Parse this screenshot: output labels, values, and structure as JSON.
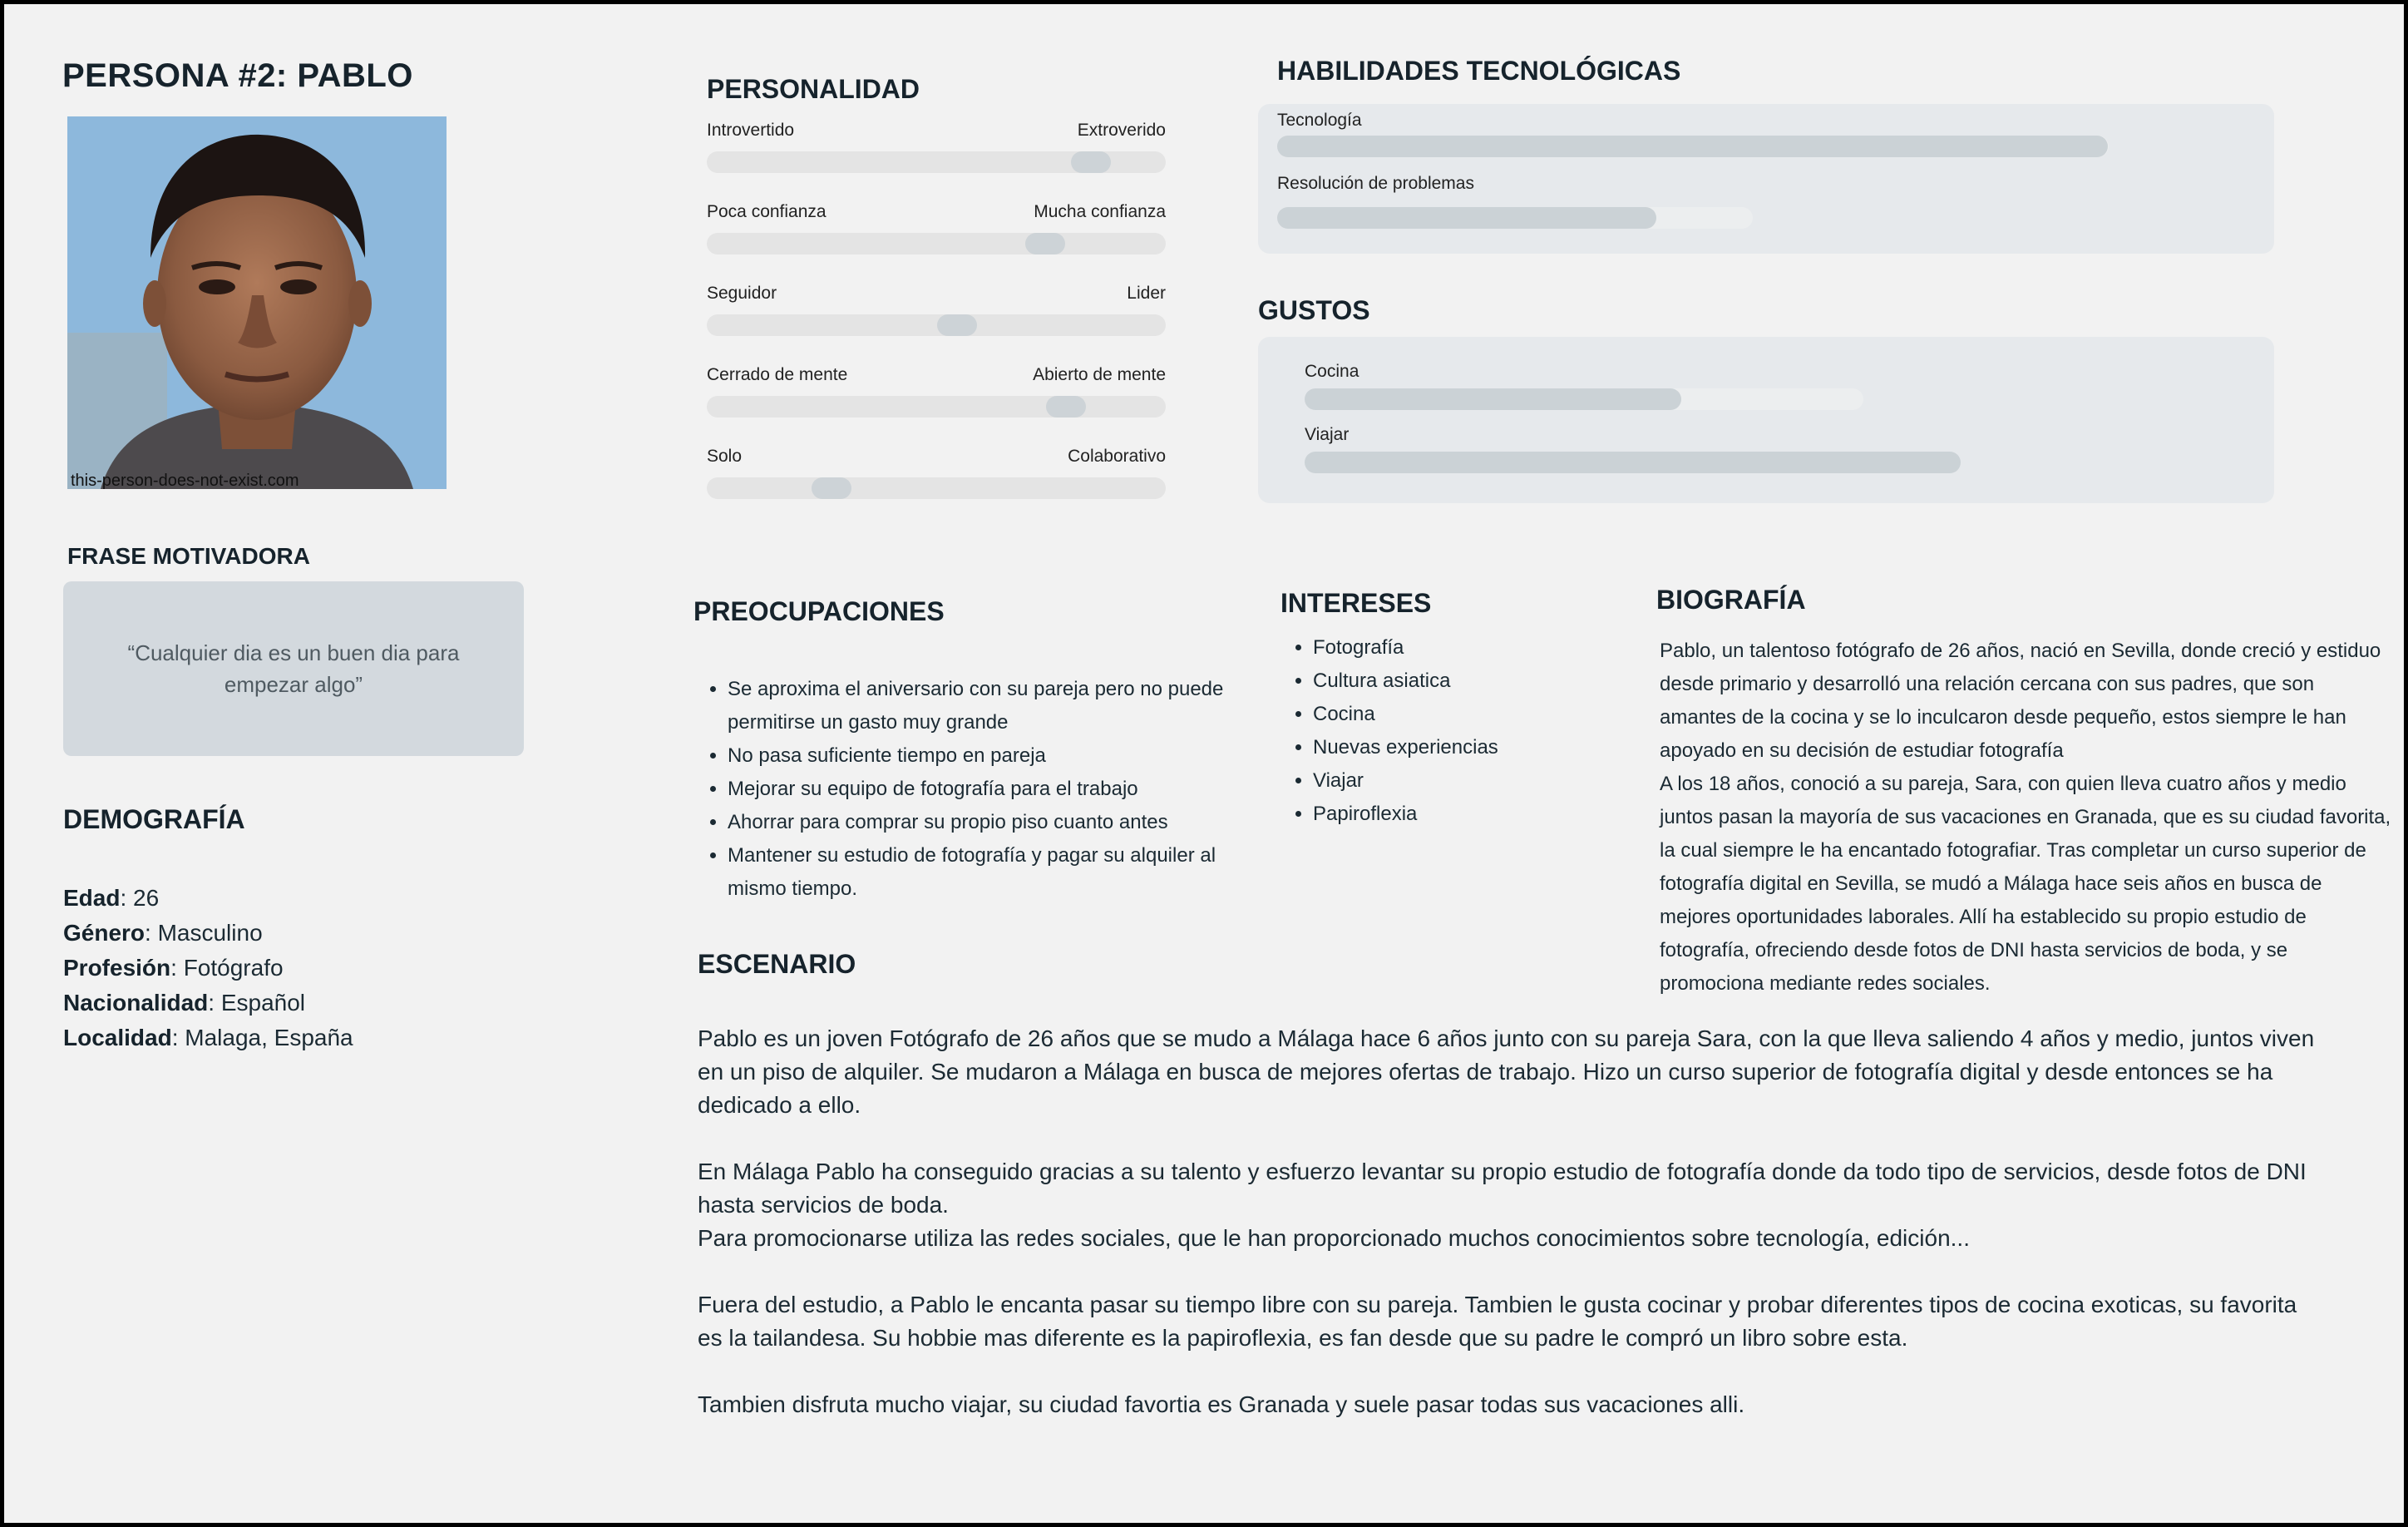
{
  "title": "PERSONA #2:  PABLO",
  "photo": {
    "credit": "this-person-does-not-exist.com"
  },
  "quote": {
    "heading": "FRASE MOTIVADORA",
    "text": "“Cualquier dia es un buen dia para empezar algo”"
  },
  "demography": {
    "heading": "DEMOGRAFÍA",
    "items": [
      {
        "key": "Edad",
        "value": ": 26"
      },
      {
        "key": "Género",
        "value": ": Masculino"
      },
      {
        "key": "Profesión",
        "value": ": Fotógrafo"
      },
      {
        "key": "Nacionalidad",
        "value": ": Español"
      },
      {
        "key": "Localidad",
        "value": ": Malaga, España"
      }
    ]
  },
  "personality": {
    "heading": "PERSONALIDAD",
    "sliders": [
      {
        "left": "Introvertido",
        "right": "Extroverido",
        "level": 0.87
      },
      {
        "left": "Poca confianza",
        "right": "Mucha confianza",
        "level": 0.76
      },
      {
        "left": "Seguidor",
        "right": "Lider",
        "level": 0.55
      },
      {
        "left": "Cerrado de mente",
        "right": "Abierto de mente",
        "level": 0.81
      },
      {
        "left": "Solo",
        "right": "Colaborativo",
        "level": 0.25
      }
    ]
  },
  "tech": {
    "heading": "HABILIDADES TECNOLÓGICAS",
    "skills": [
      {
        "label": "Tecnología",
        "level": 0.9
      },
      {
        "label": "Resolución de problemas",
        "level": 0.45
      }
    ]
  },
  "likes": {
    "heading": "GUSTOS",
    "items": [
      {
        "label": "Cocina",
        "level": 0.5
      },
      {
        "label": "Viajar",
        "level": 0.85
      }
    ]
  },
  "concerns": {
    "heading": "PREOCUPACIONES",
    "items": [
      "Se aproxima el aniversario con su pareja pero no puede permitirse un gasto muy grande",
      "No pasa suficiente tiempo en pareja",
      "Mejorar su equipo de fotografía para el trabajo",
      "Ahorrar para comprar su propio piso cuanto antes",
      "Mantener su estudio de fotografía y pagar su alquiler al mismo tiempo."
    ]
  },
  "interests": {
    "heading": "INTERESES",
    "items": [
      "Fotografía",
      "Cultura asiatica",
      "Cocina",
      "Nuevas experiencias",
      "Viajar",
      "Papiroflexia"
    ]
  },
  "biography": {
    "heading": "BIOGRAFÍA",
    "paragraphs": [
      "Pablo, un talentoso fotógrafo de 26 años, nació en Sevilla, donde creció y estiduo desde primario y desarrolló una relación cercana con sus padres, que son amantes de la cocina y se lo inculcaron desde pequeño, estos siempre le han apoyado en su decisión de estudiar fotografía",
      "A los 18 años, conoció a su pareja, Sara, con quien lleva cuatro años y medio juntos pasan la mayoría de sus vacaciones en Granada, que es su ciudad favorita, la cual siempre le ha encantado fotografiar. Tras completar un curso superior de fotografía digital en Sevilla, se mudó a Málaga hace seis años en busca de mejores oportunidades laborales.  Allí ha establecido su propio estudio de fotografía, ofreciendo desde fotos de DNI hasta servicios de boda, y se  promociona mediante redes sociales."
    ]
  },
  "scenario": {
    "heading": "ESCENARIO",
    "p1": "Pablo es un joven Fotógrafo de 26 años que se mudo a Málaga hace 6 años junto con su pareja Sara, con la que lleva saliendo 4 años y medio, juntos viven en un piso de alquiler. Se mudaron a Málaga en busca de mejores ofertas de trabajo. Hizo un curso superior de fotografía digital y desde entonces se ha dedicado a ello.",
    "p2a": "En Málaga Pablo ha conseguido gracias a su talento y esfuerzo levantar su propio estudio de fotografía donde da todo tipo de servicios, desde fotos de DNI hasta servicios de boda.",
    "p2b": "Para promocionarse utiliza las redes sociales, que le han proporcionado muchos conocimientos sobre tecnología, edición...",
    "p3": "Fuera del estudio, a Pablo le encanta pasar su tiempo libre con su pareja. Tambien le gusta cocinar y probar diferentes tipos de cocina exoticas, su favorita es la tailandesa. Su hobbie mas diferente es la papiroflexia, es fan desde que su padre le compró un libro sobre esta.",
    "p4": "Tambien disfruta mucho viajar,  su ciudad favortia es Granada y suele pasar todas sus vacaciones alli."
  }
}
